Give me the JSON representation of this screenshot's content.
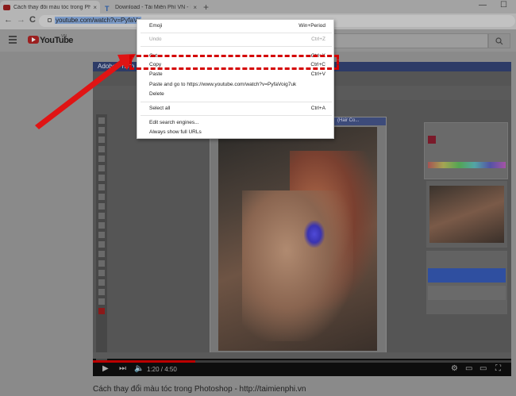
{
  "tabs": [
    {
      "title": "Cách thay đổi màu tóc trong Ph",
      "close": "×",
      "active": true
    },
    {
      "title": "Download - Tải Miễn Phí VN - Ph",
      "close": "×",
      "active": false
    }
  ],
  "new_tab": "+",
  "window_controls": {
    "minimize": "—",
    "maximize": "☐"
  },
  "nav": {
    "back": "←",
    "forward": "→",
    "reload": "C"
  },
  "address_bar": {
    "url": "youtube.com/watch?v=PyfaVo"
  },
  "youtube": {
    "logo_text": "YouTube",
    "country": "VN",
    "search_placeholder": "",
    "search_icon": "search-icon"
  },
  "video": {
    "app_title": "Adobe Photo",
    "doc_title": "(Hair Co...",
    "time": "1:20 / 4:50",
    "progress_fraction": 0.245,
    "title": "Cách thay đổi màu tóc trong Photoshop - http://taimienphi.vn"
  },
  "context_menu": {
    "items": [
      {
        "label": "Emoji",
        "shortcut": "Win+Period",
        "disabled": false
      },
      {
        "label": "Undo",
        "shortcut": "Ctrl+Z",
        "disabled": true
      },
      {
        "label": "Cut",
        "shortcut": "Ctrl+X",
        "disabled": false
      },
      {
        "label": "Copy",
        "shortcut": "Ctrl+C",
        "disabled": false
      },
      {
        "label": "Paste",
        "shortcut": "Ctrl+V",
        "disabled": false
      },
      {
        "label": "Paste and go to https://www.youtube.com/watch?v=PyfaVoig7uk",
        "shortcut": "",
        "disabled": false
      },
      {
        "label": "Delete",
        "shortcut": "",
        "disabled": false
      },
      {
        "label": "Select all",
        "shortcut": "Ctrl+A",
        "disabled": false
      },
      {
        "label": "Edit search engines...",
        "shortcut": "",
        "disabled": false
      },
      {
        "label": "Always show full URLs",
        "shortcut": "",
        "disabled": false
      }
    ]
  },
  "colors": {
    "highlight": "#d40000",
    "arrow": "#e01414",
    "youtube_red": "#9c1f1f"
  }
}
